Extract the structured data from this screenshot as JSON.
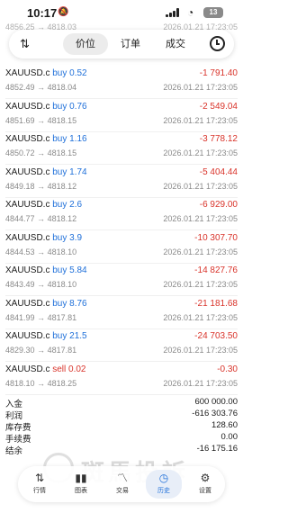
{
  "status_bar": {
    "time": "10:17",
    "mute_icon": "bell-slash-icon",
    "battery": "13"
  },
  "ghost_rows": [
    {
      "text": "4856.25 → 4818.03"
    },
    {
      "text": "2026.01.21 17:23:05"
    }
  ],
  "toolbar": {
    "tabs": [
      "价位",
      "订单",
      "成交"
    ],
    "sort_icon": "sort-icon",
    "history_icon": "clock-icon"
  },
  "trades": [
    {
      "symbol": "XAUUSD.c",
      "side": "buy",
      "volume": "0.52",
      "open": "4852.49",
      "close": "4818.04",
      "profit": "-1 791.40",
      "time": "2026.01.21 17:23:05"
    },
    {
      "symbol": "XAUUSD.c",
      "side": "buy",
      "volume": "0.76",
      "open": "4851.69",
      "close": "4818.15",
      "profit": "-2 549.04",
      "time": "2026.01.21 17:23:05"
    },
    {
      "symbol": "XAUUSD.c",
      "side": "buy",
      "volume": "1.16",
      "open": "4850.72",
      "close": "4818.15",
      "profit": "-3 778.12",
      "time": "2026.01.21 17:23:05"
    },
    {
      "symbol": "XAUUSD.c",
      "side": "buy",
      "volume": "1.74",
      "open": "4849.18",
      "close": "4818.12",
      "profit": "-5 404.44",
      "time": "2026.01.21 17:23:05"
    },
    {
      "symbol": "XAUUSD.c",
      "side": "buy",
      "volume": "2.6",
      "open": "4844.77",
      "close": "4818.12",
      "profit": "-6 929.00",
      "time": "2026.01.21 17:23:05"
    },
    {
      "symbol": "XAUUSD.c",
      "side": "buy",
      "volume": "3.9",
      "open": "4844.53",
      "close": "4818.10",
      "profit": "-10 307.70",
      "time": "2026.01.21 17:23:05"
    },
    {
      "symbol": "XAUUSD.c",
      "side": "buy",
      "volume": "5.84",
      "open": "4843.49",
      "close": "4818.10",
      "profit": "-14 827.76",
      "time": "2026.01.21 17:23:05"
    },
    {
      "symbol": "XAUUSD.c",
      "side": "buy",
      "volume": "8.76",
      "open": "4841.99",
      "close": "4817.81",
      "profit": "-21 181.68",
      "time": "2026.01.21 17:23:05"
    },
    {
      "symbol": "XAUUSD.c",
      "side": "buy",
      "volume": "21.5",
      "open": "4829.30",
      "close": "4817.81",
      "profit": "-24 703.50",
      "time": "2026.01.21 17:23:05"
    },
    {
      "symbol": "XAUUSD.c",
      "side": "sell",
      "volume": "0.02",
      "open": "4818.10",
      "close": "4818.25",
      "profit": "-0.30",
      "time": "2026.01.21 17:23:05"
    }
  ],
  "summary": [
    {
      "label": "入金",
      "value": "600 000.00"
    },
    {
      "label": "利润",
      "value": "-616 303.76"
    },
    {
      "label": "库存费",
      "value": "128.60"
    },
    {
      "label": "手续费",
      "value": "0.00"
    },
    {
      "label": "结余",
      "value": "-16 175.16"
    }
  ],
  "watermark": {
    "text": "斑馬投訴"
  },
  "nav": [
    {
      "label": "行情",
      "icon": "quotes-icon"
    },
    {
      "label": "图表",
      "icon": "chart-icon"
    },
    {
      "label": "交易",
      "icon": "trade-icon"
    },
    {
      "label": "历史",
      "icon": "history-icon"
    },
    {
      "label": "设置",
      "icon": "settings-icon"
    }
  ],
  "colors": {
    "buy": "#1e6fd9",
    "sell": "#d9342b",
    "loss": "#d9342b",
    "active": "#1e6fd9"
  }
}
